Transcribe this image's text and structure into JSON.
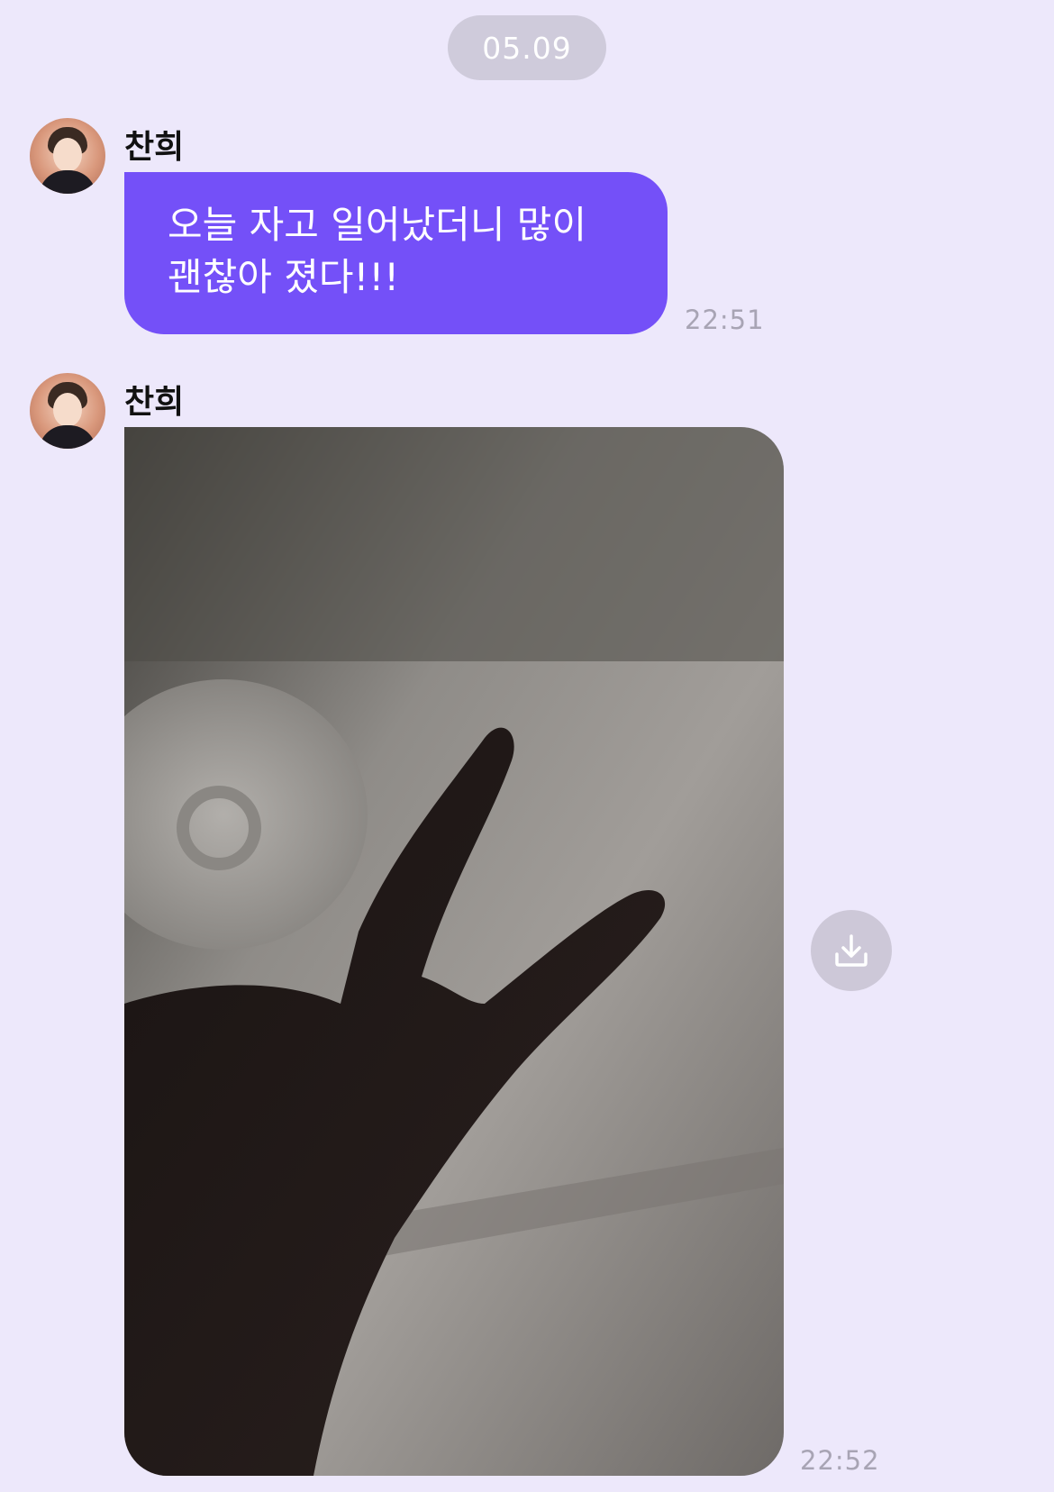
{
  "date_divider": "05.09",
  "messages": [
    {
      "sender": "찬희",
      "text_line1": "오늘 자고 일어났더니 많이",
      "text_line2": "괜찮아 졌다!!!",
      "time": "22:51"
    },
    {
      "sender": "찬희",
      "type": "photo",
      "photo_subject": "hand-peace-sign",
      "time": "22:52"
    }
  ],
  "colors": {
    "background": "#ede8fb",
    "bubble": "#7450f8",
    "date_pill": "#cfcbdb",
    "timestamp": "#a8a4b4"
  },
  "icons": {
    "download": "download-icon"
  }
}
